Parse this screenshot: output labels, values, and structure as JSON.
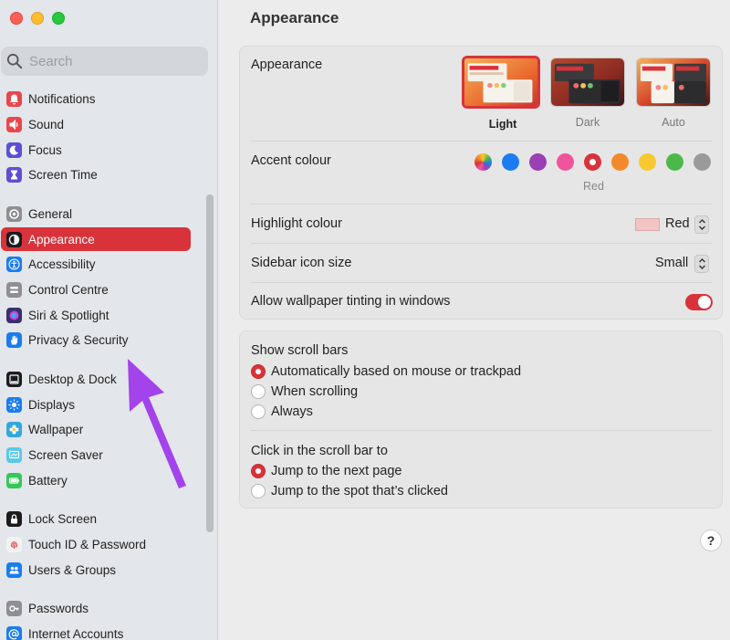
{
  "search": {
    "placeholder": "Search"
  },
  "sidebar": {
    "items": [
      {
        "label": "Notifications",
        "icon": "bell-icon",
        "color": "#e8474e"
      },
      {
        "label": "Sound",
        "icon": "speaker-icon",
        "color": "#e8474e"
      },
      {
        "label": "Focus",
        "icon": "moon-icon",
        "color": "#5b4fd6"
      },
      {
        "label": "Screen Time",
        "icon": "hourglass-icon",
        "color": "#5b4fd6"
      },
      {
        "label": "General",
        "icon": "gear-icon",
        "color": "#8e8e93"
      },
      {
        "label": "Appearance",
        "icon": "appearance-icon",
        "color": "#1c1c1e"
      },
      {
        "label": "Accessibility",
        "icon": "accessibility-icon",
        "color": "#1a7cf0"
      },
      {
        "label": "Control Centre",
        "icon": "control-centre-icon",
        "color": "#8e8e93"
      },
      {
        "label": "Siri & Spotlight",
        "icon": "siri-icon",
        "color": "#3a2f6b"
      },
      {
        "label": "Privacy & Security",
        "icon": "hand-icon",
        "color": "#1a7cf0"
      },
      {
        "label": "Desktop & Dock",
        "icon": "dock-icon",
        "color": "#1c1c1e"
      },
      {
        "label": "Displays",
        "icon": "sun-icon",
        "color": "#1a7cf0"
      },
      {
        "label": "Wallpaper",
        "icon": "flower-icon",
        "color": "#32a8e0"
      },
      {
        "label": "Screen Saver",
        "icon": "screensaver-icon",
        "color": "#5ac8e8"
      },
      {
        "label": "Battery",
        "icon": "battery-icon",
        "color": "#34c759"
      },
      {
        "label": "Lock Screen",
        "icon": "lock-icon",
        "color": "#1c1c1e"
      },
      {
        "label": "Touch ID & Password",
        "icon": "fingerprint-icon",
        "color": "#f2f2f2"
      },
      {
        "label": "Users & Groups",
        "icon": "users-icon",
        "color": "#1a7cf0"
      },
      {
        "label": "Passwords",
        "icon": "key-icon",
        "color": "#8e8e93"
      },
      {
        "label": "Internet Accounts",
        "icon": "at-icon",
        "color": "#1a7cf0"
      }
    ],
    "active_index": 5
  },
  "main": {
    "title": "Appearance",
    "appearance": {
      "label": "Appearance",
      "options": [
        {
          "label": "Light",
          "selected": true
        },
        {
          "label": "Dark",
          "selected": false
        },
        {
          "label": "Auto",
          "selected": false
        }
      ]
    },
    "accent": {
      "label": "Accent colour",
      "colors": [
        "multicolor",
        "#1a7cf0",
        "#9b3fb5",
        "#f0559b",
        "#d8333a",
        "#f3892b",
        "#f7c92e",
        "#4cb849",
        "#9a9a9a"
      ],
      "selected_index": 4,
      "selected_name": "Red"
    },
    "highlight": {
      "label": "Highlight colour",
      "value": "Red",
      "swatch": "#f2c4c6"
    },
    "sidebar_icon": {
      "label": "Sidebar icon size",
      "value": "Small"
    },
    "tinting": {
      "label": "Allow wallpaper tinting in windows",
      "on": true
    },
    "scroll_bars": {
      "label": "Show scroll bars",
      "options": [
        "Automatically based on mouse or trackpad",
        "When scrolling",
        "Always"
      ],
      "selected_index": 0
    },
    "click_scroll": {
      "label": "Click in the scroll bar to",
      "options": [
        "Jump to the next page",
        "Jump to the spot that’s clicked"
      ],
      "selected_index": 0
    },
    "help_label": "?"
  },
  "accent_color": "#d8333a"
}
